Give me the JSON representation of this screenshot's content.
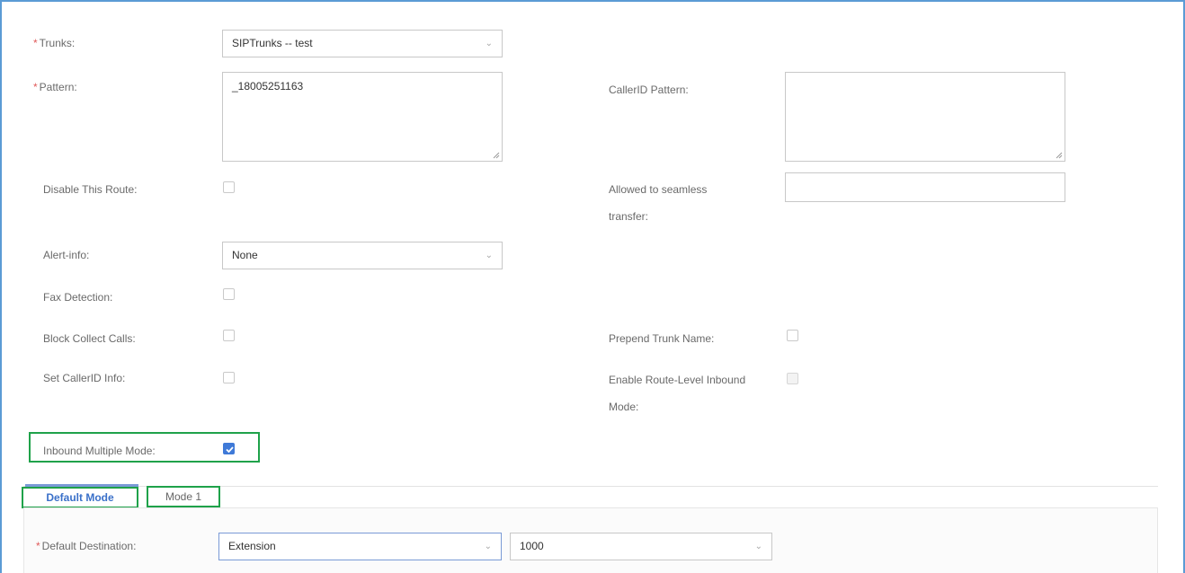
{
  "form": {
    "trunks": {
      "label": "Trunks:",
      "value": "SIPTrunks -- test"
    },
    "pattern": {
      "label": "Pattern:",
      "value": "_18005251163"
    },
    "callerid_pattern": {
      "label": "CallerID Pattern:",
      "value": ""
    },
    "disable_route": {
      "label": "Disable This Route:",
      "checked": false
    },
    "seamless_transfer": {
      "label_line1": "Allowed to seamless",
      "label_line2": "transfer:",
      "value": ""
    },
    "alert_info": {
      "label": "Alert-info:",
      "value": "None"
    },
    "fax_detection": {
      "label": "Fax Detection:",
      "checked": false
    },
    "block_collect": {
      "label": "Block Collect Calls:",
      "checked": false
    },
    "prepend_trunk": {
      "label": "Prepend Trunk Name:",
      "checked": false
    },
    "set_callerid": {
      "label": "Set CallerID Info:",
      "checked": false
    },
    "route_level_inbound": {
      "label_line1": "Enable Route-Level Inbound",
      "label_line2": "Mode:",
      "checked": false,
      "disabled": true
    },
    "inbound_multiple": {
      "label": "Inbound Multiple Mode:",
      "checked": true
    }
  },
  "tabs": [
    {
      "label": "Default Mode",
      "active": true
    },
    {
      "label": "Mode 1",
      "active": false
    }
  ],
  "default_mode": {
    "label": "Default Destination:",
    "destination_type": "Extension",
    "destination_value": "1000"
  },
  "colors": {
    "frame": "#5b9bd5",
    "highlight": "#1fa24a",
    "required": "#e05a5a",
    "accent": "#3f7ad8"
  }
}
